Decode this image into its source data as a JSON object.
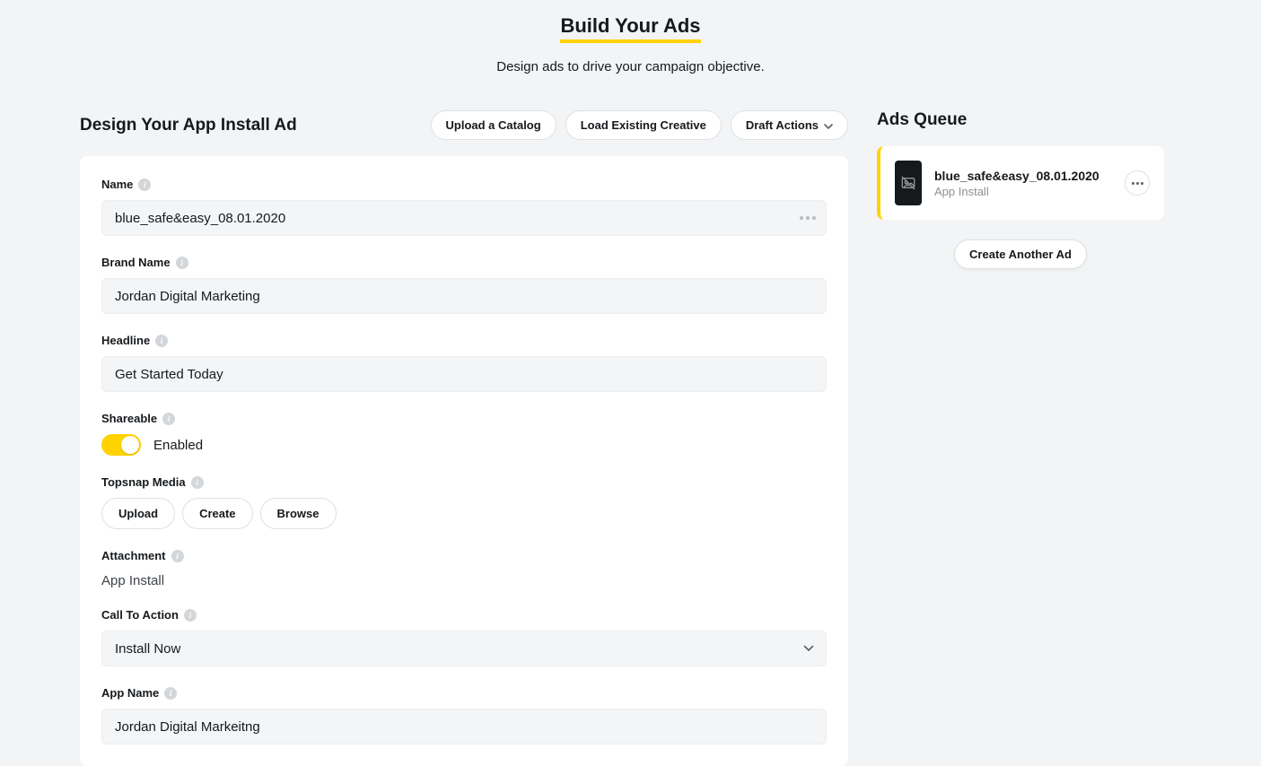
{
  "header": {
    "title": "Build Your Ads",
    "subtitle": "Design ads to drive your campaign objective."
  },
  "design": {
    "section_title": "Design Your App Install Ad",
    "buttons": {
      "upload_catalog": "Upload a Catalog",
      "load_existing": "Load Existing Creative",
      "draft_actions": "Draft Actions"
    },
    "fields": {
      "name": {
        "label": "Name",
        "value": "blue_safe&easy_08.01.2020"
      },
      "brand_name": {
        "label": "Brand Name",
        "value": "Jordan Digital Marketing"
      },
      "headline": {
        "label": "Headline",
        "value": "Get Started Today"
      },
      "shareable": {
        "label": "Shareable",
        "status": "Enabled"
      },
      "topsnap": {
        "label": "Topsnap Media",
        "upload": "Upload",
        "create": "Create",
        "browse": "Browse"
      },
      "attachment": {
        "label": "Attachment",
        "value": "App Install"
      },
      "cta": {
        "label": "Call To Action",
        "value": "Install Now"
      },
      "app_name": {
        "label": "App Name",
        "value": "Jordan Digital Markeitng"
      }
    }
  },
  "queue": {
    "section_title": "Ads Queue",
    "item": {
      "title": "blue_safe&easy_08.01.2020",
      "type": "App Install"
    },
    "create_another": "Create Another Ad"
  }
}
